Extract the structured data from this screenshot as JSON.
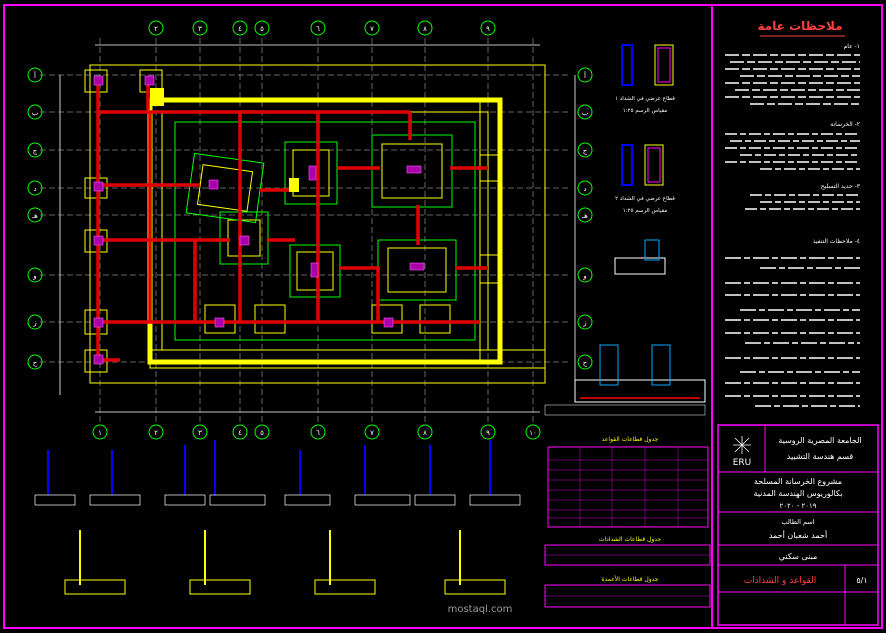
{
  "notes": {
    "heading": "ملاحظات عامة",
    "sections": [
      "١- عام",
      "٢- الخرسانة",
      "٣- حديد التسليح",
      "٤- ملاحظات التنفيذ"
    ]
  },
  "title_block": {
    "university_line1": "الجامعة المصرية الروسية",
    "university_line2": "قسم هندسة التشييد",
    "logo_text": "ERU",
    "project_line1": "مشروع الخرسانة المسلحة",
    "project_line2": "بكالوريوس الهندسة المدنية",
    "project_years": "٢٠١٩ - ٢٠٢٠",
    "student_label": "اسم الطالب",
    "student_name": "أحمد شعبان أحمد",
    "building_label": "مبنى سكني",
    "drawing_title": "القواعد و الشدادات",
    "sheet_no": "٥/١"
  },
  "tables": {
    "footings_schedule_title": "جدول قطاعات القواعد",
    "tie_beams_schedule_title": "جدول قطاعات الشدادات",
    "columns_schedule_title": "جدول قطاعات الأعمدة"
  },
  "axes": {
    "top": [
      "١",
      "٢",
      "٣",
      "٤",
      "٥",
      "٦",
      "٧",
      "٨",
      "٩",
      "١٠"
    ],
    "bottom": [
      "١",
      "٢",
      "٣",
      "٤",
      "٥",
      "٦",
      "٧",
      "٨",
      "٩",
      "١٠"
    ],
    "left": [
      "أ",
      "ب",
      "ج",
      "د",
      "هـ",
      "و",
      "ز",
      "ح"
    ],
    "right": [
      "أ",
      "ب",
      "ج",
      "د",
      "هـ",
      "و",
      "ز",
      "ح"
    ]
  },
  "section_labels": {
    "sec1": "قطاع عرضي في الشداد ١",
    "sec2": "قطاع عرضي في الشداد ٢",
    "scale": "مقياس الرسم ١:٢٥"
  },
  "watermark": "mostaql.com"
}
